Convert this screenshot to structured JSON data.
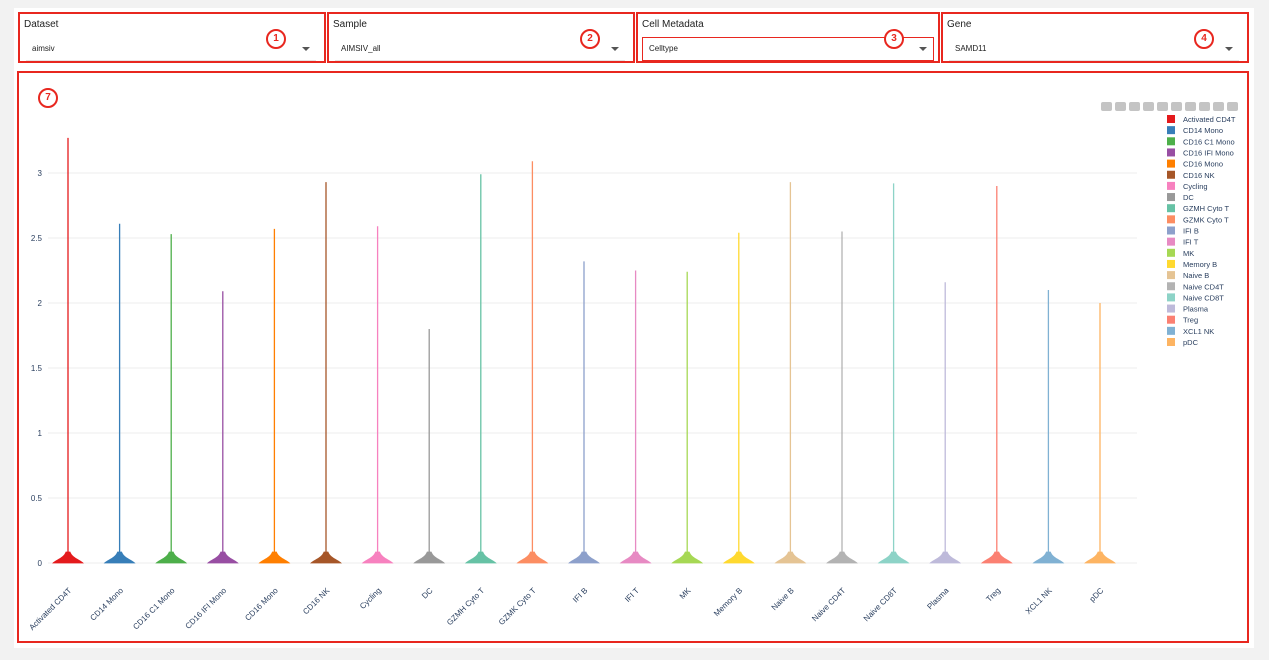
{
  "controls": {
    "dataset": {
      "label": "Dataset",
      "value": "aimsiv",
      "badge": "1"
    },
    "sample": {
      "label": "Sample",
      "value": "AIMSIV_all",
      "badge": "2"
    },
    "metadata": {
      "label": "Cell Metadata",
      "value": "Celltype",
      "badge": "3"
    },
    "gene": {
      "label": "Gene",
      "value": "SAMD11",
      "badge": "4"
    }
  },
  "plot": {
    "badge": "7"
  },
  "modebar": {
    "icons": [
      "camera-icon",
      "zoom-icon",
      "pan-icon",
      "zoom-in-icon",
      "zoom-out-icon",
      "autoscale-icon",
      "home-icon",
      "spike-lines-icon",
      "hover-closest-icon",
      "hover-compare-icon"
    ]
  },
  "chart_data": {
    "type": "violin",
    "categories": [
      "Activated CD4T",
      "CD14 Mono",
      "CD16 C1 Mono",
      "CD16 IFI Mono",
      "CD16 Mono",
      "CD16 NK",
      "Cycling",
      "DC",
      "GZMH Cyto T",
      "GZMK Cyto T",
      "IFI B",
      "IFI T",
      "MK",
      "Memory B",
      "Naive B",
      "Naive CD4T",
      "Naive CD8T",
      "Plasma",
      "Treg",
      "XCL1 NK",
      "pDC"
    ],
    "max_values": [
      3.27,
      2.61,
      2.53,
      2.09,
      2.57,
      2.93,
      2.59,
      1.8,
      2.99,
      3.09,
      2.32,
      2.25,
      2.24,
      2.54,
      2.93,
      2.55,
      2.92,
      2.16,
      2.9,
      2.1,
      2.0
    ],
    "colors": [
      "#e41a1c",
      "#377eb8",
      "#4daf4a",
      "#984ea3",
      "#ff7f00",
      "#a65628",
      "#f781bf",
      "#999999",
      "#66c2a5",
      "#fc8d62",
      "#8da0cb",
      "#e78ac3",
      "#a6d854",
      "#ffd92f",
      "#e5c494",
      "#b3b3b3",
      "#8dd3c7",
      "#bebada",
      "#fb8072",
      "#80b1d3",
      "#fdb462"
    ],
    "ylim": [
      0,
      3.3
    ],
    "yticks": [
      0,
      0.5,
      1,
      1.5,
      2,
      2.5,
      3
    ],
    "ytick_labels": [
      "0",
      "0.5",
      "1",
      "1.5",
      "2",
      "2.5",
      "3"
    ],
    "grid": true,
    "legend_position": "right"
  }
}
